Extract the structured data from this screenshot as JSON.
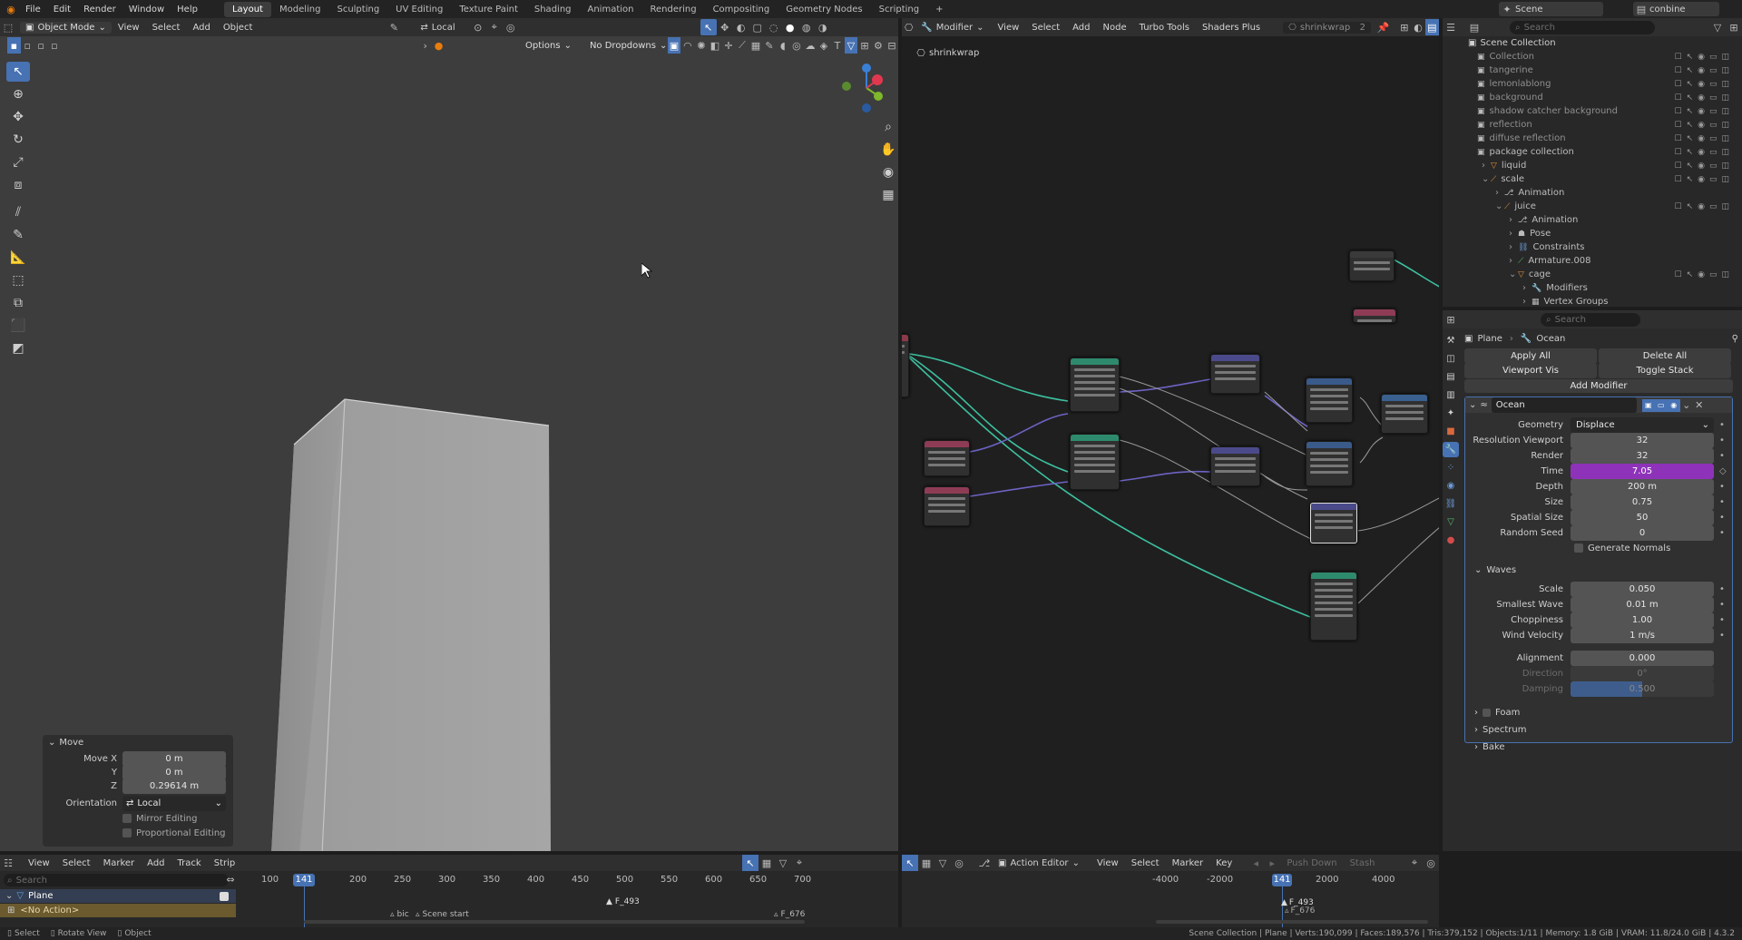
{
  "topbar": {
    "menus": [
      "File",
      "Edit",
      "Render",
      "Window",
      "Help"
    ],
    "workspaces": [
      "Layout",
      "Modeling",
      "Sculpting",
      "UV Editing",
      "Texture Paint",
      "Shading",
      "Animation",
      "Rendering",
      "Compositing",
      "Geometry Nodes",
      "Scripting"
    ],
    "active_workspace": "Layout",
    "plus": "+",
    "scene_label": "Scene",
    "view_layer_label": "conbine"
  },
  "viewport": {
    "mode": "Object Mode",
    "menus": [
      "View",
      "Select",
      "Add",
      "Object"
    ],
    "transform_orientation": "Local",
    "options_label": "Options",
    "dropdown_label": "No Dropdowns",
    "operator_panel": {
      "title": "Move",
      "move_x_label": "Move X",
      "move_x": "0 m",
      "y_label": "Y",
      "y": "0 m",
      "z_label": "Z",
      "z": "0.29614 m",
      "orientation_label": "Orientation",
      "orientation": "Local",
      "mirror_label": "Mirror Editing",
      "proportional_label": "Proportional Editing"
    }
  },
  "node_editor": {
    "editor_type": "Modifier",
    "menus": [
      "View",
      "Select",
      "Add",
      "Node",
      "Turbo Tools",
      "Shaders Plus"
    ],
    "tree_name": "shrinkwrap",
    "users": "2",
    "breadcrumb": "shrinkwrap"
  },
  "outliner": {
    "search_placeholder": "Search",
    "root": "Scene Collection",
    "items": [
      {
        "name": "Collection",
        "depth": 1
      },
      {
        "name": "tangerine",
        "depth": 1
      },
      {
        "name": "lemonlablong",
        "depth": 1
      },
      {
        "name": "background",
        "depth": 1
      },
      {
        "name": "shadow catcher background",
        "depth": 1
      },
      {
        "name": "reflection",
        "depth": 1
      },
      {
        "name": "diffuse reflection",
        "depth": 1
      },
      {
        "name": "package collection",
        "depth": 1
      },
      {
        "name": "liquid",
        "depth": 2
      },
      {
        "name": "scale",
        "depth": 2
      },
      {
        "name": "Animation",
        "depth": 3
      },
      {
        "name": "juice",
        "depth": 3
      },
      {
        "name": "Animation",
        "depth": 4
      },
      {
        "name": "Pose",
        "depth": 4
      },
      {
        "name": "Constraints",
        "depth": 4
      },
      {
        "name": "Armature.008",
        "depth": 4
      },
      {
        "name": "cage",
        "depth": 4
      },
      {
        "name": "Modifiers",
        "depth": 5
      },
      {
        "name": "Vertex Groups",
        "depth": 5
      }
    ]
  },
  "properties": {
    "search_placeholder": "Search",
    "breadcrumb": [
      "Plane",
      "Ocean"
    ],
    "apply_all": "Apply All",
    "delete_all": "Delete All",
    "viewport_vis": "Viewport Vis",
    "toggle_stack": "Toggle Stack",
    "add_modifier": "Add Modifier",
    "modifier_name": "Ocean",
    "fields": [
      {
        "label": "Geometry",
        "value": "Displace",
        "kind": "dropdown"
      },
      {
        "label": "Resolution Viewport",
        "value": "32"
      },
      {
        "label": "Render",
        "value": "32"
      },
      {
        "label": "Time",
        "value": "7.05",
        "kind": "animated"
      },
      {
        "label": "Depth",
        "value": "200 m"
      },
      {
        "label": "Size",
        "value": "0.75"
      },
      {
        "label": "Spatial Size",
        "value": "50"
      },
      {
        "label": "Random Seed",
        "value": "0"
      }
    ],
    "generate_normals": "Generate Normals",
    "waves_title": "Waves",
    "waves": [
      {
        "label": "Scale",
        "value": "0.050"
      },
      {
        "label": "Smallest Wave",
        "value": "0.01 m"
      },
      {
        "label": "Choppiness",
        "value": "1.00"
      },
      {
        "label": "Wind Velocity",
        "value": "1 m/s"
      }
    ],
    "alignment_label": "Alignment",
    "alignment": "0.000",
    "direction_label": "Direction",
    "direction": "0°",
    "damping_label": "Damping",
    "damping": "0.500",
    "sections": [
      "Foam",
      "Spectrum",
      "Bake"
    ]
  },
  "timeline": {
    "menus": [
      "View",
      "Select",
      "Marker",
      "Add",
      "Track",
      "Strip"
    ],
    "search_placeholder": "Search",
    "channel": "Plane",
    "no_action": "<No Action>",
    "ticks": [
      "100",
      "200",
      "250",
      "300",
      "350",
      "400",
      "450",
      "500",
      "550",
      "600",
      "650",
      "700"
    ],
    "current_frame": "141",
    "markers": [
      "bic",
      "Scene start",
      "F_493",
      "F_676"
    ]
  },
  "action_editor": {
    "mode": "Action Editor",
    "menus": [
      "View",
      "Select",
      "Marker",
      "Key"
    ],
    "push_down": "Push Down",
    "stash": "Stash",
    "ticks": [
      "-4000",
      "-2000",
      "2000",
      "4000"
    ],
    "current_frame": "141",
    "markers": [
      "F_493",
      "F_676"
    ]
  },
  "statusbar": {
    "left": [
      "Select",
      "Rotate View",
      "Object"
    ],
    "right": "Scene Collection | Plane | Verts:190,099 | Faces:189,576 | Tris:379,152 | Objects:1/11 | Memory: 1.8 GiB | VRAM: 11.8/24.0 GiB | 4.3.2"
  }
}
